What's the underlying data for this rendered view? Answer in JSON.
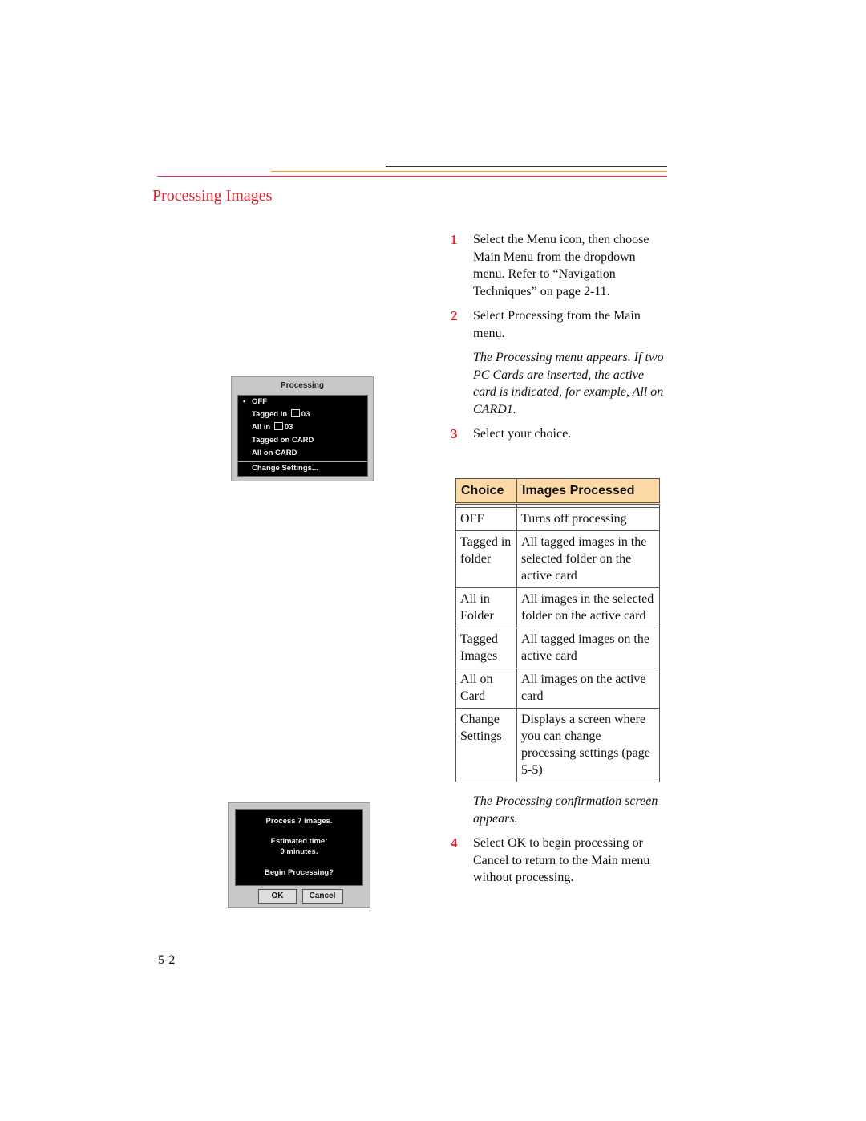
{
  "page": {
    "title": "Processing Images",
    "page_number": "5-2",
    "accent_color": "#e0202e"
  },
  "steps": [
    {
      "num": "1",
      "text": "Select the Menu icon, then choose Main Menu from the dropdown menu. Refer to “Navigation Techniques” on page 2-11."
    },
    {
      "num": "2",
      "text": "Select Processing from the Main menu.",
      "note": "The Processing menu appears. If two PC Cards are inserted, the active card is indicated, for example, All on CARD1."
    },
    {
      "num": "3",
      "text": "Select your choice."
    },
    {
      "num": "4",
      "pre_note": "The Processing confirmation screen appears.",
      "text": "Select OK to begin processing or Cancel to return to the Main menu without processing."
    }
  ],
  "table": {
    "headers": [
      "Choice",
      "Images Processed"
    ],
    "rows": [
      [
        "OFF",
        "Turns off processing"
      ],
      [
        "Tagged in folder",
        "All tagged images in the selected folder on the active card"
      ],
      [
        "All in Folder",
        "All images in the selected folder on the active card"
      ],
      [
        "Tagged Images",
        "All tagged images on the active card"
      ],
      [
        "All on Card",
        "All images on the active card"
      ],
      [
        "Change Settings",
        "Displays a screen where you can change processing settings (page 5-5)"
      ]
    ]
  },
  "processing_menu": {
    "title": "Processing",
    "items": [
      {
        "label": "OFF",
        "selected": true
      },
      {
        "label": "Tagged in",
        "folder": "03"
      },
      {
        "label": "All in",
        "folder": "03"
      },
      {
        "label": "Tagged on CARD"
      },
      {
        "label": "All on CARD"
      }
    ],
    "footer_item": "Change Settings..."
  },
  "confirm_screen": {
    "line1": "Process 7 images.",
    "line2": "Estimated time:",
    "line3": "9 minutes.",
    "line4": "Begin Processing?",
    "ok_label": "OK",
    "cancel_label": "Cancel"
  }
}
